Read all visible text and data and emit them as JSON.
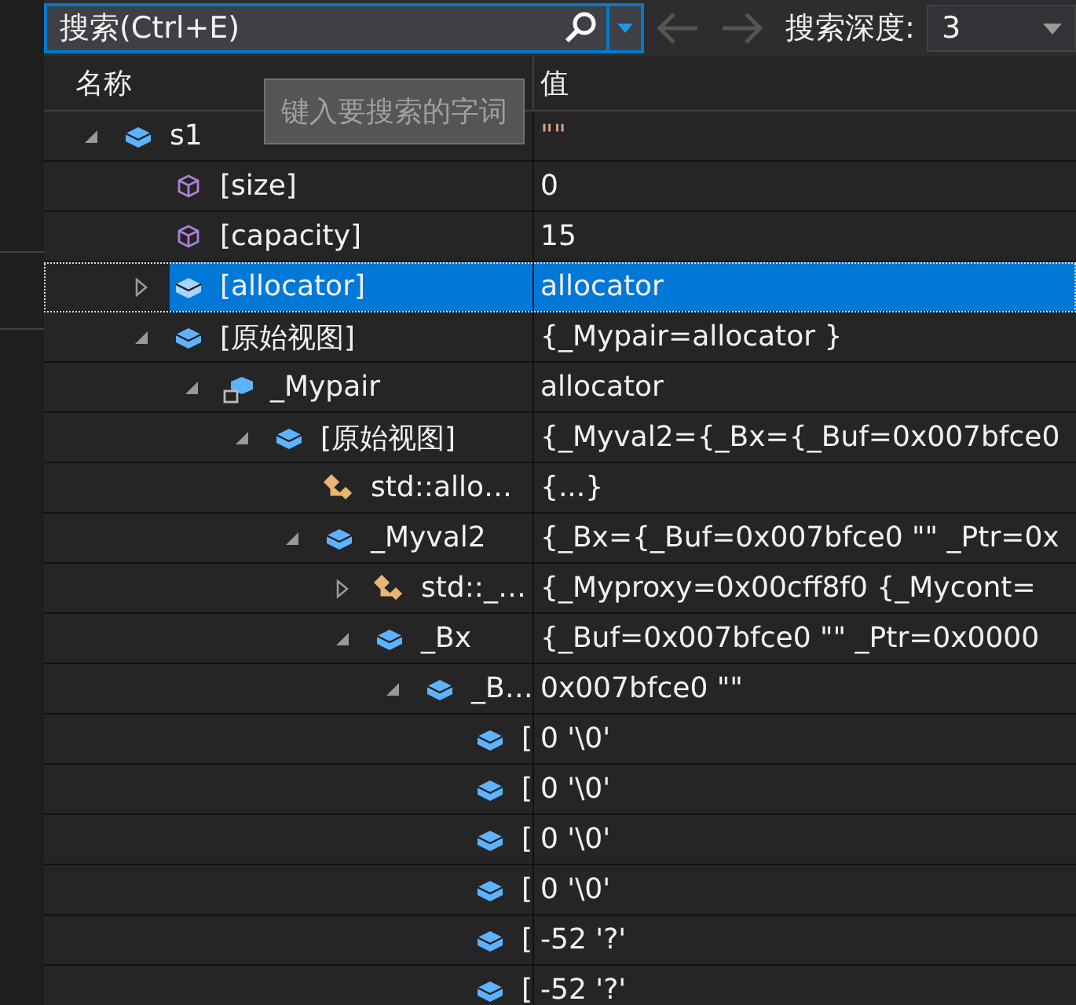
{
  "search": {
    "placeholder": "搜索(Ctrl+E)",
    "back_disabled": true,
    "forward_disabled": true,
    "depth_label": "搜索深度:",
    "depth_value": "3"
  },
  "columns": [
    "名称",
    "值"
  ],
  "tooltip": "键入要搜索的字词",
  "rows": [
    {
      "name": "s1",
      "value": "\"\"",
      "kind": "field",
      "expanded": true,
      "selected": false,
      "color": "#d69d85",
      "children": [
        {
          "name": "[size]",
          "value": "0",
          "kind": "property",
          "selected": false
        },
        {
          "name": "[capacity]",
          "value": "15",
          "kind": "property",
          "selected": false
        },
        {
          "name": "[allocator]",
          "value": "allocator",
          "kind": "field",
          "expanded": false,
          "selected": true
        },
        {
          "name": "[原始视图]",
          "value": "{_Mypair=allocator }",
          "kind": "field",
          "expanded": true,
          "selected": false,
          "children": [
            {
              "name": "_Mypair",
              "value": "allocator",
              "kind": "private",
              "expanded": true,
              "selected": false,
              "children": [
                {
                  "name": "[原始视图]",
                  "value": "{_Myval2={_Bx={_Buf=0x007bfce0",
                  "kind": "field",
                  "expanded": true,
                  "selected": false,
                  "children": [
                    {
                      "name": "std::allo…",
                      "value": "{...}",
                      "kind": "base",
                      "selected": false
                    },
                    {
                      "name": "_Myval2",
                      "value": "{_Bx={_Buf=0x007bfce0 \"\" _Ptr=0x",
                      "kind": "field",
                      "expanded": true,
                      "selected": false,
                      "children": [
                        {
                          "name": "std::_…",
                          "value": "{_Myproxy=0x00cff8f0 {_Mycont=",
                          "kind": "base",
                          "expanded": false,
                          "selected": false
                        },
                        {
                          "name": "_Bx",
                          "value": "{_Buf=0x007bfce0 \"\" _Ptr=0x0000",
                          "kind": "field",
                          "expanded": true,
                          "selected": false,
                          "children": [
                            {
                              "name": "_B…",
                              "value": "0x007bfce0 \"\"",
                              "kind": "field",
                              "expanded": true,
                              "selected": false,
                              "children": [
                                {
                                  "name": "[",
                                  "value": "0 '\\0'",
                                  "kind": "field",
                                  "selected": false
                                },
                                {
                                  "name": "[",
                                  "value": "0 '\\0'",
                                  "kind": "field",
                                  "selected": false
                                },
                                {
                                  "name": "[",
                                  "value": "0 '\\0'",
                                  "kind": "field",
                                  "selected": false
                                },
                                {
                                  "name": "[",
                                  "value": "0 '\\0'",
                                  "kind": "field",
                                  "selected": false
                                },
                                {
                                  "name": "[",
                                  "value": "-52 '?'",
                                  "kind": "field",
                                  "selected": false
                                },
                                {
                                  "name": "[",
                                  "value": "-52 '?'",
                                  "kind": "field",
                                  "selected": false
                                }
                              ]
                            }
                          ]
                        }
                      ]
                    }
                  ]
                }
              ]
            }
          ]
        }
      ]
    }
  ]
}
